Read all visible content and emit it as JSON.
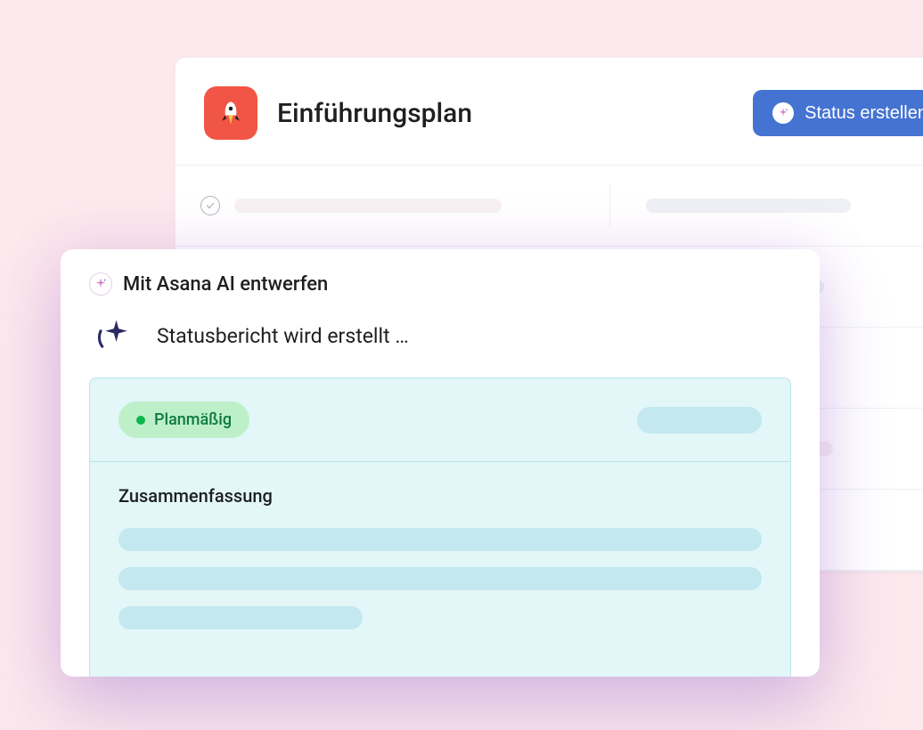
{
  "project": {
    "title": "Einführungsplan",
    "icon": "rocket-icon",
    "status_button_label": "Status erstellen"
  },
  "ai_modal": {
    "title": "Mit Asana AI entwerfen",
    "progress_text": "Statusbericht wird erstellt …",
    "status_pill_label": "Planmäßig",
    "summary_heading": "Zusammenfassung"
  },
  "colors": {
    "accent_red": "#f15545",
    "accent_blue": "#4573d2",
    "pill_green_bg": "#bdf0c9",
    "pill_green_text": "#0d7a3e",
    "panel_teal": "#e3f6f8",
    "pink_bg": "#fce8ed"
  }
}
